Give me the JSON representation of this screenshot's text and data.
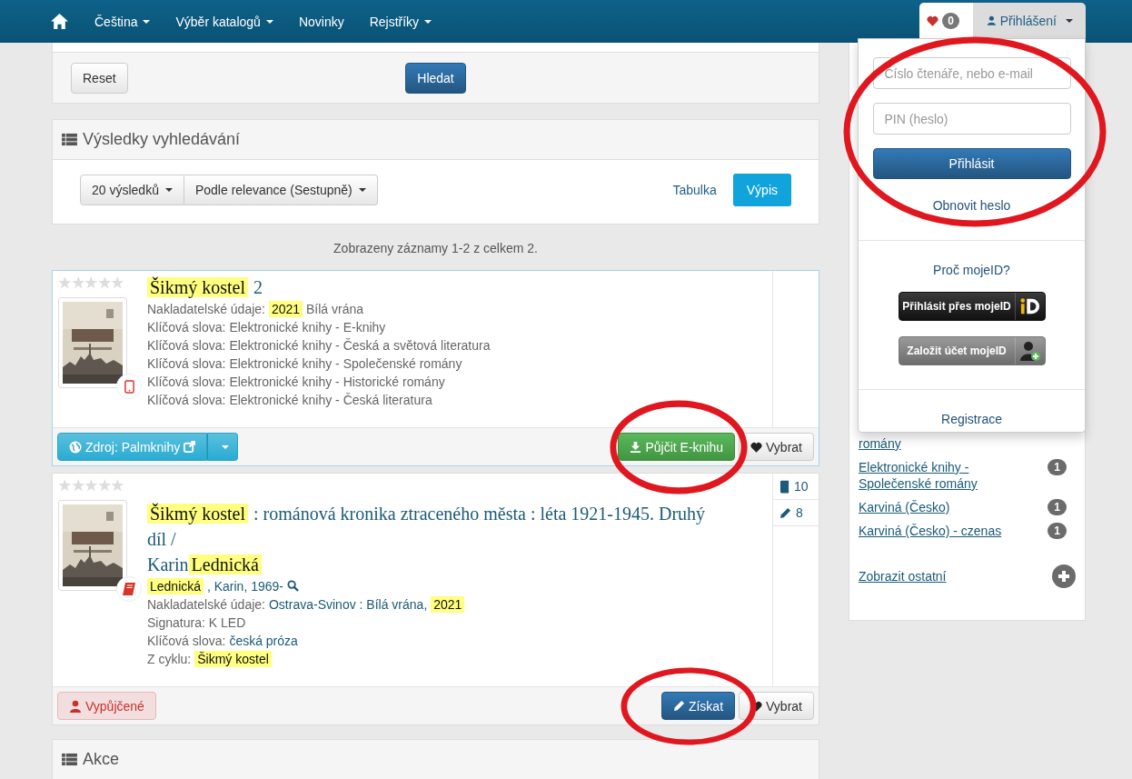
{
  "navbar": {
    "items": [
      {
        "label": "Čeština",
        "dropdown": true
      },
      {
        "label": "Výběr katalogů",
        "dropdown": true
      },
      {
        "label": "Novinky",
        "dropdown": false
      },
      {
        "label": "Rejstříky",
        "dropdown": true
      }
    ],
    "favorites_count": "0",
    "login": {
      "label": "Přihlášení",
      "expanded": true
    }
  },
  "search_form": {
    "buttons": [
      {
        "label": "Reset",
        "kind": "default"
      },
      {
        "label": "Hledat",
        "kind": "primary"
      }
    ]
  },
  "results_panel": {
    "title": "Výsledky vyhledávání",
    "page_size": "20 výsledků",
    "sort": "Podle relevance (Sestupně)",
    "views": [
      {
        "label": "Tabulka",
        "selected": false
      },
      {
        "label": "Výpis",
        "selected": true
      }
    ]
  },
  "summary": "Zobrazeny záznamy 1-2 z celkem 2.",
  "records": [
    {
      "focused": true,
      "stars": 0,
      "kind": "ebook",
      "title": [
        {
          "text": "Šikmý kostel",
          "highlight": true
        },
        {
          "text": "2",
          "highlight": false
        }
      ],
      "lines": [
        {
          "label": "Nakladatelské údaje:",
          "parts": [
            {
              "text": "2021",
              "highlight": true
            },
            {
              "text": "Bílá vrána"
            }
          ]
        },
        {
          "label": "Klíčová slova:",
          "parts": [
            {
              "text": "Elektronické knihy - E-knihy"
            }
          ]
        },
        {
          "label": "Klíčová slova:",
          "parts": [
            {
              "text": "Elektronické knihy - Česká a světová literatura"
            }
          ]
        },
        {
          "label": "Klíčová slova:",
          "parts": [
            {
              "text": "Elektronické knihy - Společenské romány"
            }
          ]
        },
        {
          "label": "Klíčová slova:",
          "parts": [
            {
              "text": "Elektronické knihy - Historické romány"
            }
          ]
        },
        {
          "label": "Klíčová slova:",
          "parts": [
            {
              "text": "Elektronické knihy - Česká literatura"
            }
          ]
        }
      ],
      "footer_left": {
        "kind": "source",
        "label": "Zdroj: Palmknihy"
      },
      "actions": [
        {
          "kind": "ebook",
          "label": "Půjčit E-knihu",
          "circled": true
        },
        {
          "kind": "select",
          "label": "Vybrat",
          "circled": false
        }
      ]
    },
    {
      "focused": false,
      "stars": 0,
      "kind": "book",
      "title": [
        {
          "text": "Šikmý kostel",
          "highlight": true
        },
        {
          "text": ": románová kronika ztraceného města : léta 1921-1945. Druhý díl /",
          "highlight": false
        }
      ],
      "author": [
        {
          "text": "Karin",
          "highlight": false
        },
        {
          "text": "Lednická",
          "highlight": true
        }
      ],
      "lines": [
        {
          "parts": [
            {
              "text": "Lednická",
              "highlight": true
            },
            {
              "text": ", Karin, 1969-",
              "link": true
            }
          ],
          "search": true
        },
        {
          "label": "Nakladatelské údaje:",
          "parts": [
            {
              "text": "Ostrava-Svinov : Bílá vrána,",
              "link": true
            },
            {
              "text": "2021",
              "highlight": true
            }
          ]
        },
        {
          "label": "Signatura:",
          "parts": [
            {
              "text": "K LED"
            }
          ]
        },
        {
          "label": "Klíčová slova:",
          "parts": [
            {
              "text": "česká próza",
              "link": true
            }
          ]
        },
        {
          "label": "Z cyklu:",
          "parts": [
            {
              "text": "Šikmý kostel",
              "highlight": true
            }
          ]
        }
      ],
      "stats": [
        {
          "kind": "copies",
          "value": "10"
        },
        {
          "kind": "reviews",
          "value": "8"
        }
      ],
      "footer_left": {
        "kind": "status",
        "label": "Vypůjčené"
      },
      "actions": [
        {
          "kind": "get",
          "label": "Získat",
          "circled": true
        },
        {
          "kind": "select",
          "label": "Vybrat",
          "circled": false
        }
      ]
    }
  ],
  "actions_panel": {
    "title": "Akce"
  },
  "login_menu": {
    "circled": true,
    "fields": [
      {
        "placeholder": "Číslo čtenáře, nebo e-mail"
      },
      {
        "placeholder": "PIN (heslo)"
      }
    ],
    "submit": "Přihlásit",
    "reset_link": "Obnovit heslo",
    "mojeid_link": "Proč mojeID?",
    "mojeid_buttons": [
      {
        "kind": "login",
        "label": "Přihlásit přes mojeID"
      },
      {
        "kind": "create",
        "label": "Založit účet mojeID"
      }
    ],
    "register": "Registrace"
  },
  "facets": {
    "items": [
      {
        "label": "romány"
      },
      {
        "label": "Elektronické knihy - Společenské romány",
        "count": "1"
      },
      {
        "label": "Karviná (Česko)",
        "count": "1"
      },
      {
        "label": "Karviná (Česko) - czenas",
        "count": "1"
      }
    ],
    "more": "Zobrazit ostatní"
  }
}
